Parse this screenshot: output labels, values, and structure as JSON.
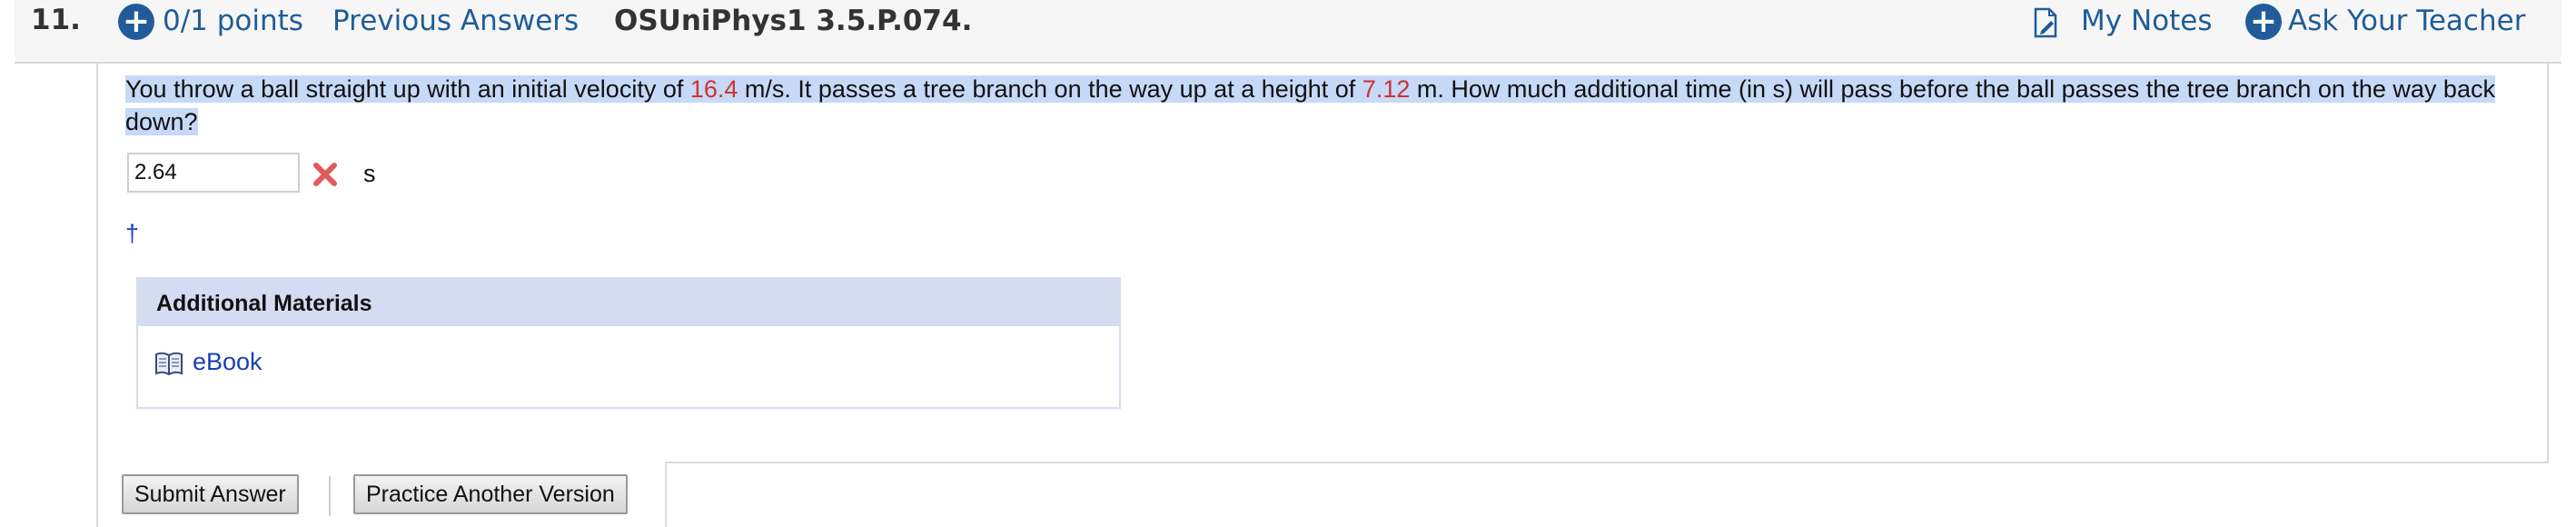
{
  "header": {
    "question_number": "11.",
    "points": "0/1 points",
    "previous_answers": "Previous Answers",
    "assignment_code": "OSUniPhys1 3.5.P.074.",
    "my_notes": "My Notes",
    "ask_teacher": "Ask Your Teacher"
  },
  "question": {
    "part1": "You throw a ball straight up with an initial velocity of ",
    "velocity": "16.4",
    "part2": " m/s. It passes a tree branch on the way up at a height of ",
    "height": "7.12",
    "part3": " m. How much additional time (in s) will pass before the ball passes the tree branch on the way back down?"
  },
  "answer": {
    "value": "2.64",
    "unit": "s",
    "status": "incorrect"
  },
  "footnote_mark": "†",
  "materials": {
    "title": "Additional Materials",
    "ebook": "eBook"
  },
  "buttons": {
    "submit": "Submit Answer",
    "practice": "Practice Another Version"
  },
  "colors": {
    "link": "#1f5c99",
    "given_value": "#d0302f",
    "wrong_mark": "#e05a5a",
    "highlight": "#c6d9f7"
  }
}
